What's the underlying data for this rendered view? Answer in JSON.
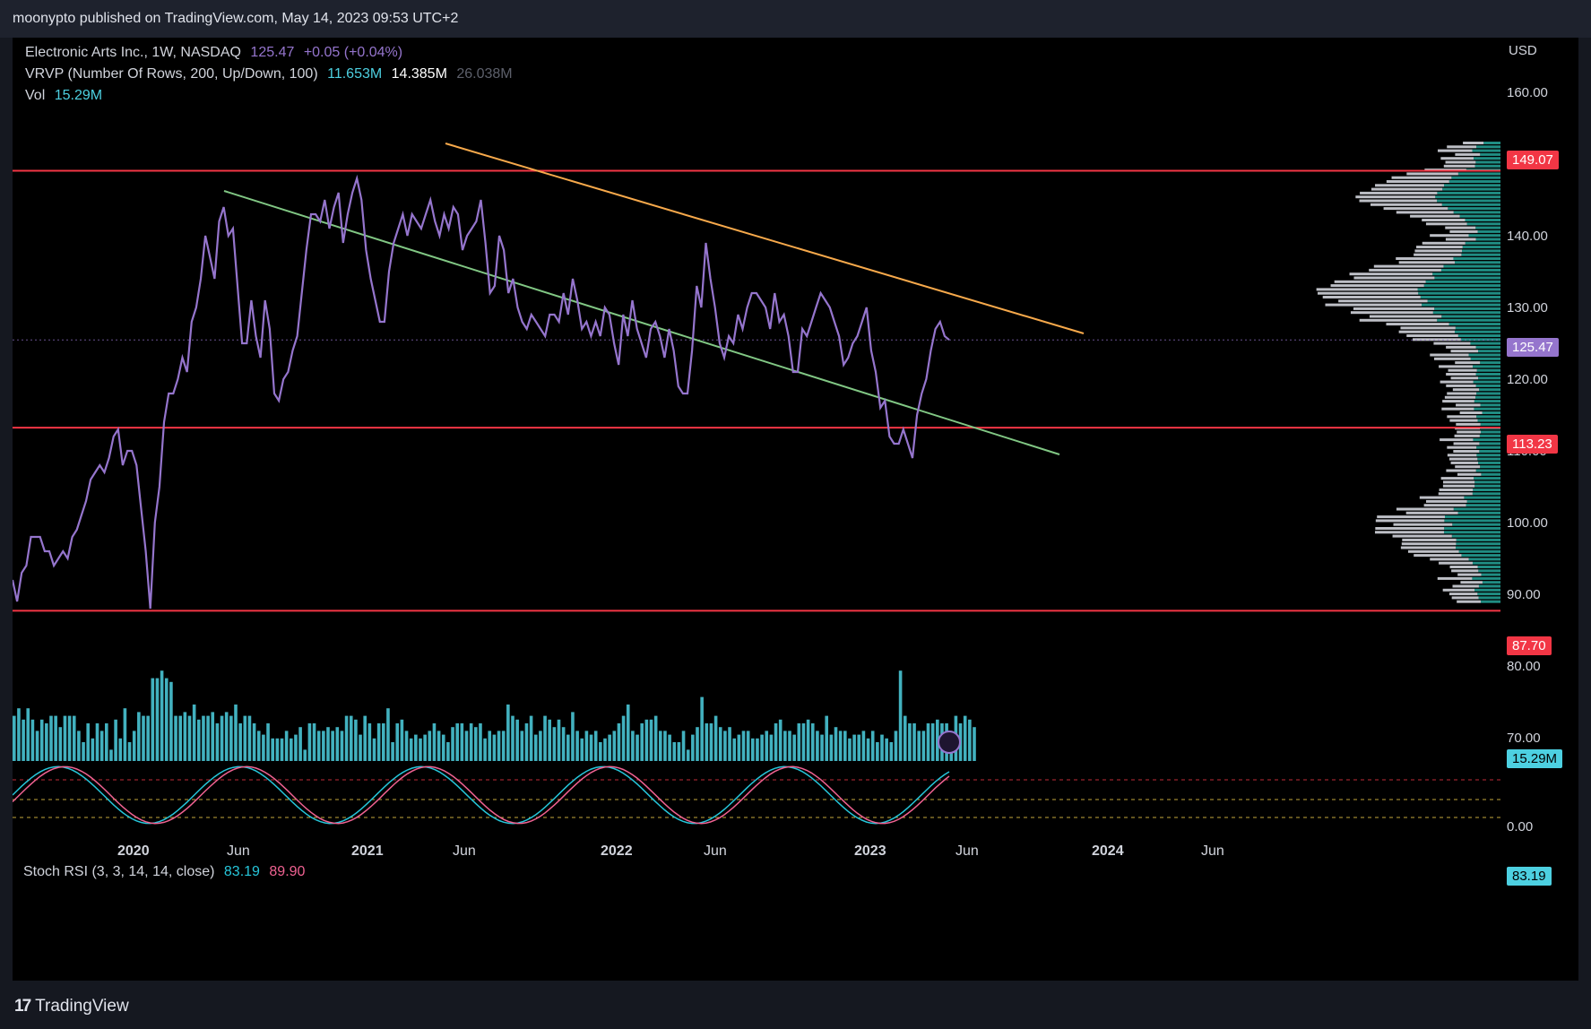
{
  "header": {
    "publish_line": "moonypto published on TradingView.com, May 14, 2023 09:53 UTC+2"
  },
  "legend": {
    "symbol": "Electronic Arts Inc., 1W, NASDAQ",
    "last": "125.47",
    "change": "+0.05 (+0.04%)",
    "vrvp_label": "VRVP (Number Of Rows, 200, Up/Down, 100)",
    "vrvp_up": "11.653M",
    "vrvp_down": "14.385M",
    "vrvp_total": "26.038M",
    "vol_label": "Vol",
    "vol_value": "15.29M",
    "stoch_label": "Stoch RSI (3, 3, 14, 14, close)",
    "stoch_k": "83.19",
    "stoch_d": "89.90"
  },
  "price_axis": {
    "currency": "USD",
    "ticks": [
      "160.00",
      "140.00",
      "130.00",
      "120.00",
      "110.00",
      "100.00",
      "90.00",
      "80.00",
      "70.00"
    ],
    "rsi_ticks": [
      "0.00"
    ]
  },
  "time_axis": {
    "ticks": [
      "2020",
      "Jun",
      "2021",
      "Jun",
      "2022",
      "Jun",
      "2023",
      "Jun",
      "2024",
      "Jun"
    ]
  },
  "badges": {
    "resistance": "149.07",
    "last_price": "125.47",
    "support": "113.23",
    "low": "87.70",
    "volume": "15.29M",
    "stoch": "83.19"
  },
  "footer": {
    "brand": "TradingView"
  },
  "colors": {
    "price": "#9575cd",
    "level": "#f23645",
    "upper_trend": "#f7a94b",
    "lower_trend": "#81c784",
    "volume": "#4dd0e1",
    "stoch_k": "#26c6da",
    "stoch_d": "#f06292"
  },
  "chart_data": {
    "type": "line",
    "x_axis": "weekly, late 2019 to May 2023",
    "ylim": [
      87.7,
      160
    ],
    "horizontal_levels": [
      149.07,
      113.23,
      87.7
    ],
    "last_price": 125.47,
    "series": [
      {
        "values": [
          92,
          89,
          93,
          94,
          98,
          98,
          98,
          96,
          96,
          94,
          95,
          96,
          95,
          98,
          99,
          101,
          103,
          106,
          107,
          108,
          107,
          109,
          112,
          113,
          108,
          110,
          110,
          108,
          102,
          96,
          88,
          100,
          105,
          114,
          118,
          118,
          120,
          123,
          121,
          128,
          130,
          134,
          140,
          137,
          134,
          142,
          144,
          140,
          141,
          133,
          125,
          125,
          131,
          126,
          123,
          131,
          127,
          118,
          117,
          120,
          121,
          124,
          126,
          132,
          138,
          143,
          143,
          142,
          145,
          141,
          144,
          146,
          139,
          143,
          146,
          148,
          145,
          138,
          134,
          131,
          128,
          128,
          135,
          139,
          141,
          143,
          140,
          143,
          142,
          141,
          143,
          145,
          142,
          140,
          143,
          141,
          144,
          143,
          138,
          140,
          141,
          142,
          145,
          139,
          132,
          133,
          140,
          138,
          132,
          134,
          130,
          128,
          127,
          129,
          128,
          127,
          126,
          129,
          129,
          128,
          132,
          129,
          134,
          131,
          127,
          128,
          126,
          128,
          126,
          130,
          129,
          125,
          122,
          129,
          126,
          131,
          127,
          125,
          123,
          127,
          128,
          126,
          123,
          127,
          124,
          119,
          118,
          118,
          124,
          133,
          130,
          139,
          134,
          130,
          125,
          123,
          126,
          125,
          129,
          127,
          130,
          132,
          132,
          131,
          130,
          127,
          132,
          128,
          129,
          126,
          121,
          121,
          127,
          126,
          128,
          130,
          132,
          131,
          130,
          128,
          126,
          122,
          123,
          125,
          126,
          128,
          130,
          124,
          121,
          116,
          117,
          112,
          111,
          111,
          113,
          111,
          109,
          115,
          118,
          120,
          124,
          127,
          128,
          126,
          125.47
        ]
      }
    ],
    "volume_series": [
      70,
      72,
      69,
      72,
      69,
      66,
      69,
      68,
      70,
      70,
      67,
      70,
      70,
      70,
      66,
      63,
      68,
      64,
      68,
      66,
      68,
      61,
      69,
      64,
      72,
      63,
      66,
      71,
      70,
      70,
      80,
      80,
      82,
      80,
      79,
      70,
      70,
      71,
      70,
      73,
      69,
      70,
      70,
      71,
      68,
      70,
      71,
      70,
      73,
      68,
      70,
      70,
      68,
      66,
      65,
      68,
      64,
      64,
      64,
      66,
      64,
      65,
      67,
      61,
      68,
      68,
      66,
      66,
      67,
      66,
      67,
      66,
      70,
      70,
      69,
      65,
      70,
      68,
      64,
      68,
      68,
      72,
      63,
      68,
      69,
      66,
      64,
      65,
      64,
      65,
      66,
      68,
      66,
      65,
      63,
      67,
      68,
      68,
      66,
      68,
      67,
      68,
      64,
      66,
      65,
      66,
      66,
      73,
      70,
      69,
      66,
      68,
      70,
      65,
      66,
      70,
      69,
      67,
      69,
      67,
      65,
      71,
      66,
      64,
      66,
      65,
      66,
      63,
      64,
      65,
      66,
      68,
      70,
      73,
      66,
      65,
      68,
      69,
      69,
      70,
      66,
      66,
      65,
      63,
      63,
      66,
      61,
      65,
      67,
      75,
      68,
      68,
      70,
      67,
      66,
      67,
      64,
      65,
      66,
      66,
      64,
      64,
      65,
      66,
      65,
      68,
      69,
      66,
      66,
      65,
      68,
      68,
      69,
      68,
      66,
      65,
      70,
      65,
      67,
      66,
      66,
      64,
      65,
      65,
      66,
      64,
      66,
      63,
      65,
      64,
      63,
      66,
      82,
      70,
      68,
      68,
      66,
      66,
      68,
      68,
      69,
      68,
      68,
      66,
      70,
      68,
      70,
      69,
      67
    ]
  }
}
